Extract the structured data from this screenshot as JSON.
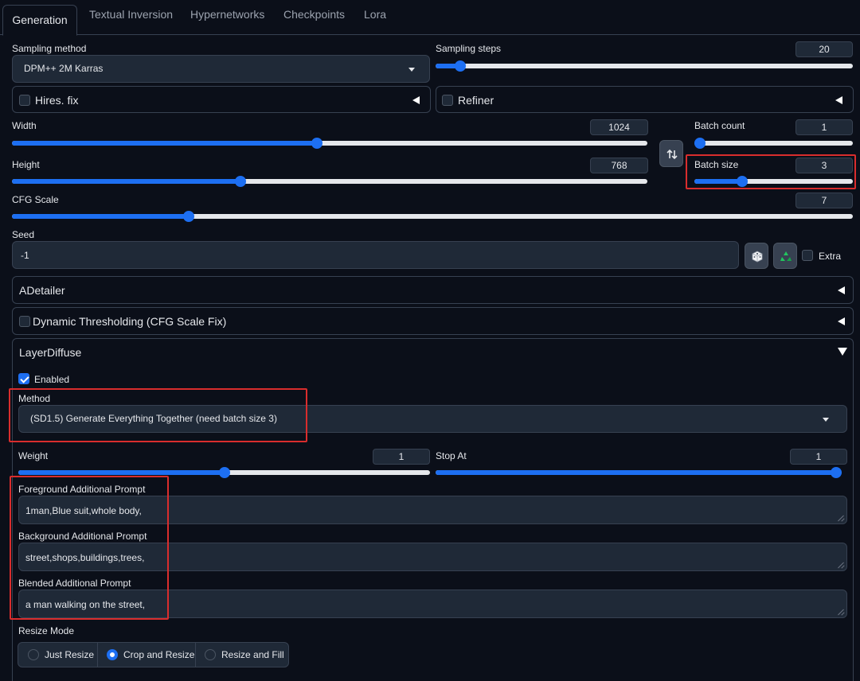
{
  "tabs": [
    "Generation",
    "Textual Inversion",
    "Hypernetworks",
    "Checkpoints",
    "Lora"
  ],
  "sampling_method": {
    "label": "Sampling method",
    "value": "DPM++ 2M Karras"
  },
  "sampling_steps": {
    "label": "Sampling steps",
    "value": "20",
    "fraction": 0.06
  },
  "hires_fix": {
    "label": "Hires. fix"
  },
  "refiner": {
    "label": "Refiner"
  },
  "width": {
    "label": "Width",
    "value": "1024",
    "fraction": 0.48
  },
  "height": {
    "label": "Height",
    "value": "768",
    "fraction": 0.36
  },
  "batch_count": {
    "label": "Batch count",
    "value": "1",
    "fraction": 0.0
  },
  "batch_size": {
    "label": "Batch size",
    "value": "3",
    "fraction": 0.3
  },
  "cfg_scale": {
    "label": "CFG Scale",
    "value": "7",
    "fraction": 0.21
  },
  "seed": {
    "label": "Seed",
    "value": "-1",
    "extra_label": "Extra"
  },
  "adetailer": {
    "label": "ADetailer"
  },
  "dynamic_thresholding": {
    "label": "Dynamic Thresholding (CFG Scale Fix)"
  },
  "layerdiffuse": {
    "label": "LayerDiffuse",
    "enabled_label": "Enabled",
    "enabled": true,
    "method_label": "Method",
    "method_value": "(SD1.5) Generate Everything Together (need batch size 3)",
    "weight_label": "Weight",
    "weight_value": "1",
    "weight_fraction": 0.5,
    "stop_at_label": "Stop At",
    "stop_at_value": "1",
    "stop_at_fraction": 1.0,
    "foreground_label": "Foreground Additional Prompt",
    "foreground_value": "1man,Blue suit,whole body,",
    "background_label": "Background Additional Prompt",
    "background_value": "street,shops,buildings,trees,",
    "blended_label": "Blended Additional Prompt",
    "blended_value": "a man walking on the street,",
    "resize_mode_label": "Resize Mode",
    "resize_options": [
      "Just Resize",
      "Crop and Resize",
      "Resize and Fill"
    ],
    "resize_selected": "Crop and Resize"
  },
  "colors": {
    "accent": "#1d6ff2",
    "background": "#0b0f19",
    "panel": "#1f2937",
    "border": "#374151",
    "highlight": "#d92d2d"
  }
}
